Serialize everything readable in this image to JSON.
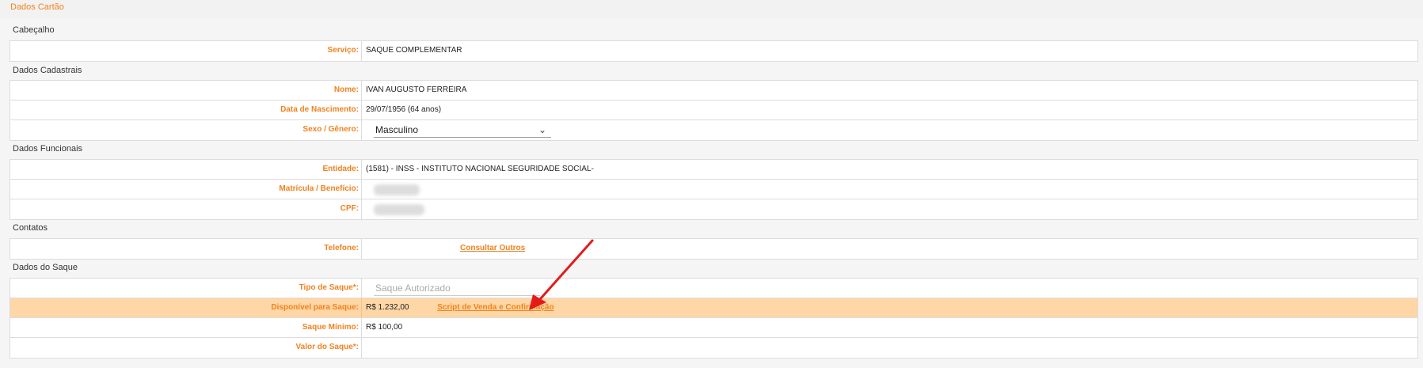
{
  "panel": {
    "title": "Dados Cartão"
  },
  "sections": {
    "cabecalho": {
      "header": "Cabeçalho",
      "servico_label": "Serviço:",
      "servico_value": "SAQUE COMPLEMENTAR"
    },
    "cadastrais": {
      "header": "Dados Cadastrais",
      "nome_label": "Nome:",
      "nome_value": "IVAN AUGUSTO FERREIRA",
      "nascimento_label": "Data de Nascimento:",
      "nascimento_value": "29/07/1956 (64 anos)",
      "sexo_label": "Sexo / Gênero:",
      "sexo_value": "Masculino"
    },
    "funcionais": {
      "header": "Dados Funcionais",
      "entidade_label": "Entidade:",
      "entidade_value": "(1581) - INSS - INSTITUTO NACIONAL SEGURIDADE SOCIAL-",
      "matricula_label": "Matrícula / Benefício:",
      "cpf_label": "CPF:"
    },
    "contatos": {
      "header": "Contatos",
      "telefone_label": "Telefone:",
      "consultar_link": "Consultar Outros"
    },
    "saque": {
      "header": "Dados do Saque",
      "tipo_label": "Tipo de Saque*:",
      "tipo_placeholder": "Saque Autorizado",
      "disponivel_label": "Disponível para Saque:",
      "disponivel_value": "R$ 1.232,00",
      "script_link": "Script de Venda e Confirmação",
      "minimo_label": "Saque Mínimo:",
      "minimo_value": "R$ 100,00",
      "valor_label": "Valor do Saque*:"
    }
  },
  "colors": {
    "accent": "#f0821e",
    "highlight": "#ffd6a5",
    "arrow": "#e31b1b"
  },
  "icons": {
    "select_chevron": "chevron-down-icon",
    "annotation": "red-arrow-annotation"
  }
}
